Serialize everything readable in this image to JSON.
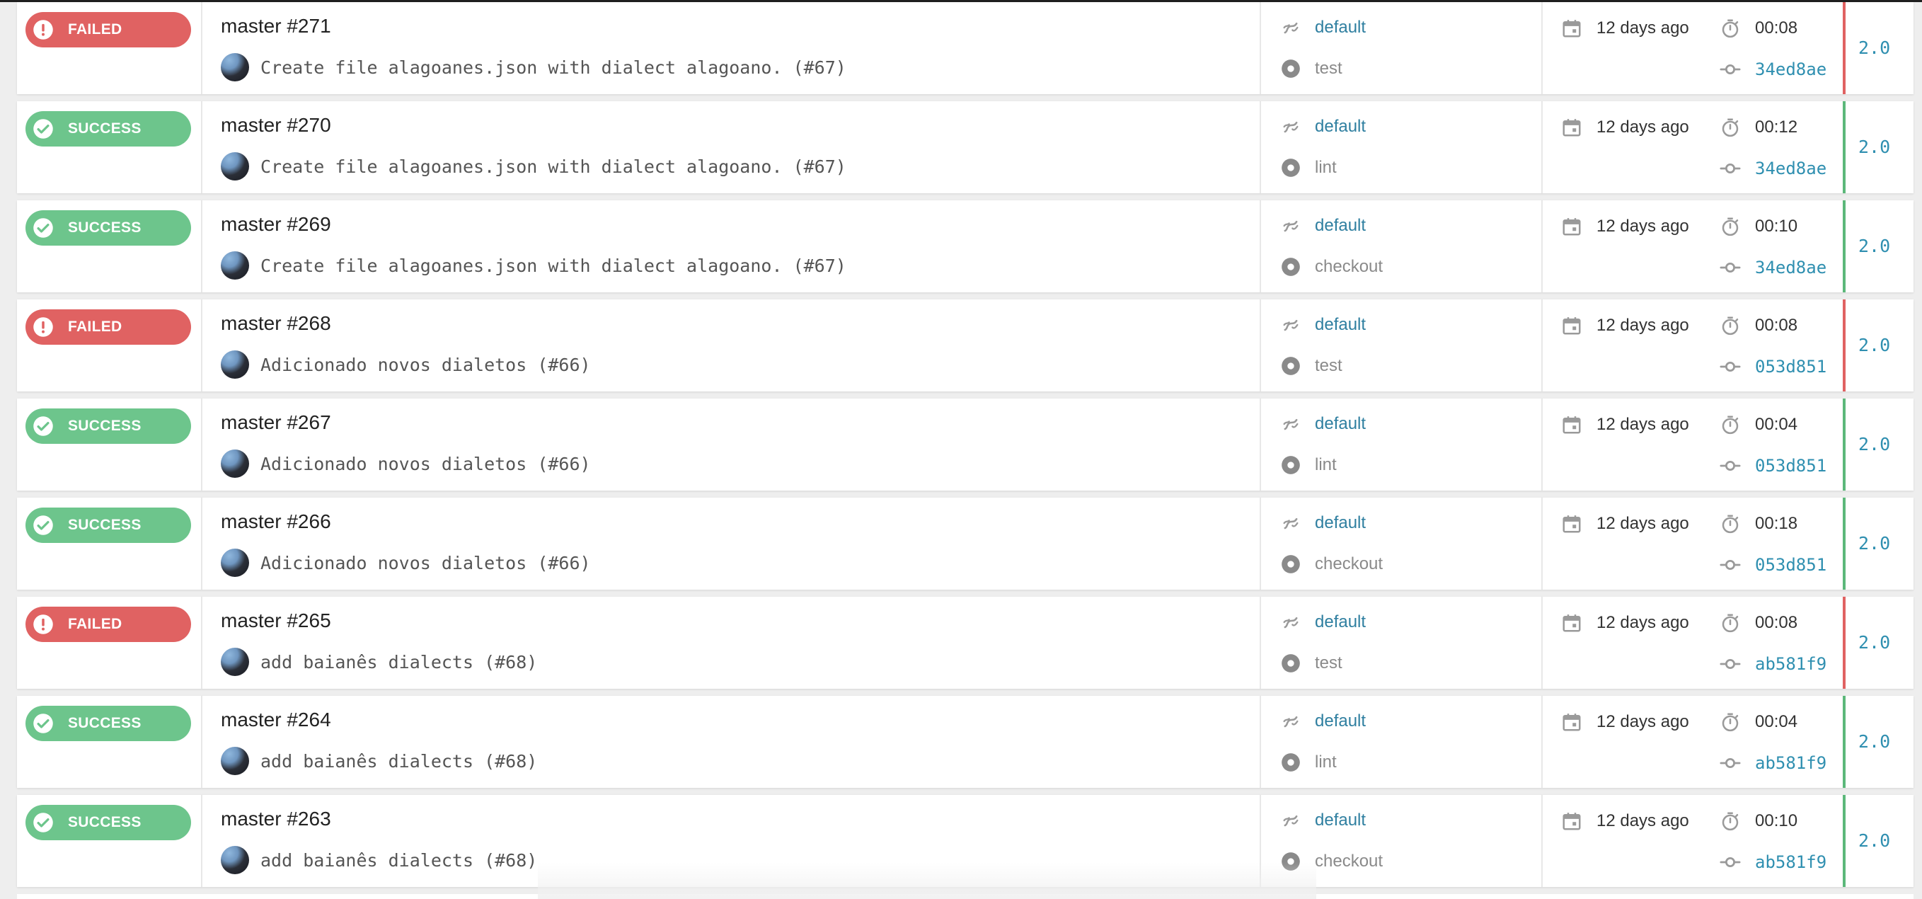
{
  "colors": {
    "success": "#6dc58c",
    "failed": "#e06262",
    "link": "#2f7fa0",
    "sha": "#2f8fb0"
  },
  "icons": {
    "success": "check-circle-icon",
    "failed": "exclamation-circle-icon",
    "pipeline": "pipeline-link-icon",
    "step": "step-dot-icon",
    "date": "calendar-icon",
    "duration": "stopwatch-icon",
    "commit": "commit-icon"
  },
  "builds": [
    {
      "status": "FAILED",
      "title": "master #271",
      "message": "Create file alagoanes.json with dialect alagoano. (#67)",
      "pipeline": "default",
      "step": "test",
      "started": "12 days ago",
      "duration": "00:08",
      "sha": "34ed8ae",
      "version": "2.0"
    },
    {
      "status": "SUCCESS",
      "title": "master #270",
      "message": "Create file alagoanes.json with dialect alagoano. (#67)",
      "pipeline": "default",
      "step": "lint",
      "started": "12 days ago",
      "duration": "00:12",
      "sha": "34ed8ae",
      "version": "2.0"
    },
    {
      "status": "SUCCESS",
      "title": "master #269",
      "message": "Create file alagoanes.json with dialect alagoano. (#67)",
      "pipeline": "default",
      "step": "checkout",
      "started": "12 days ago",
      "duration": "00:10",
      "sha": "34ed8ae",
      "version": "2.0"
    },
    {
      "status": "FAILED",
      "title": "master #268",
      "message": "Adicionado novos dialetos (#66)",
      "pipeline": "default",
      "step": "test",
      "started": "12 days ago",
      "duration": "00:08",
      "sha": "053d851",
      "version": "2.0"
    },
    {
      "status": "SUCCESS",
      "title": "master #267",
      "message": "Adicionado novos dialetos (#66)",
      "pipeline": "default",
      "step": "lint",
      "started": "12 days ago",
      "duration": "00:04",
      "sha": "053d851",
      "version": "2.0"
    },
    {
      "status": "SUCCESS",
      "title": "master #266",
      "message": "Adicionado novos dialetos (#66)",
      "pipeline": "default",
      "step": "checkout",
      "started": "12 days ago",
      "duration": "00:18",
      "sha": "053d851",
      "version": "2.0"
    },
    {
      "status": "FAILED",
      "title": "master #265",
      "message": "add baianês dialects (#68)",
      "pipeline": "default",
      "step": "test",
      "started": "12 days ago",
      "duration": "00:08",
      "sha": "ab581f9",
      "version": "2.0"
    },
    {
      "status": "SUCCESS",
      "title": "master #264",
      "message": "add baianês dialects (#68)",
      "pipeline": "default",
      "step": "lint",
      "started": "12 days ago",
      "duration": "00:04",
      "sha": "ab581f9",
      "version": "2.0"
    },
    {
      "status": "SUCCESS",
      "title": "master #263",
      "message": "add baianês dialects (#68)",
      "pipeline": "default",
      "step": "checkout",
      "started": "12 days ago",
      "duration": "00:10",
      "sha": "ab581f9",
      "version": "2.0"
    }
  ]
}
